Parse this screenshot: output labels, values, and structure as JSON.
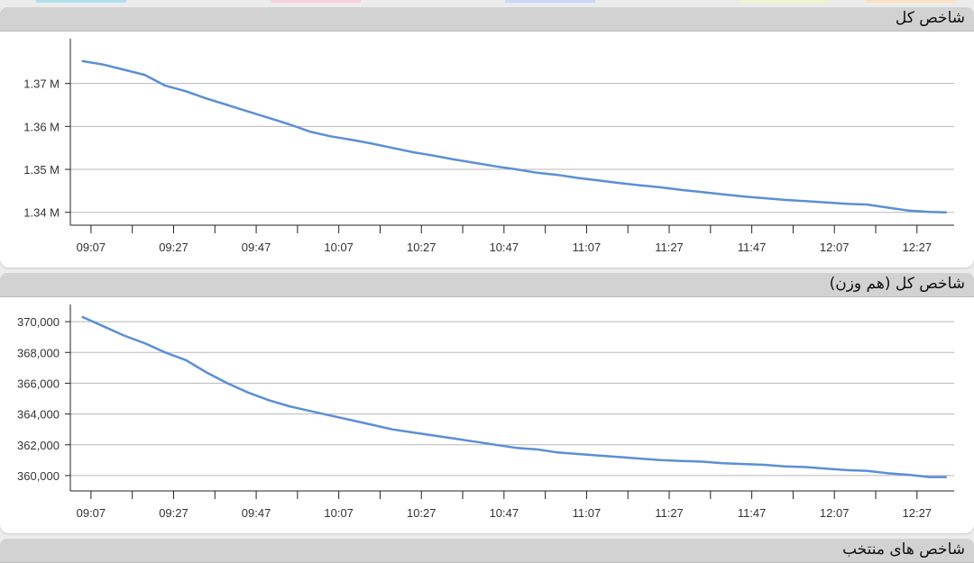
{
  "colors": {
    "line": "#5b8fd6",
    "grid": "#b8b8b8",
    "axis": "#222222",
    "header_bg": "#d2d2d2"
  },
  "top_tabs": [
    {
      "name": "tab-1",
      "color": "#aee0f0"
    },
    {
      "name": "tab-2",
      "color": "#f6d0dc"
    },
    {
      "name": "tab-3",
      "color": "#c9d8f7"
    },
    {
      "name": "tab-4",
      "color": "#f0f4c8"
    },
    {
      "name": "tab-5",
      "color": "#fde0c0"
    }
  ],
  "panels": [
    {
      "title": "شاخص کل"
    },
    {
      "title": "شاخص کل (هم وزن)"
    },
    {
      "title": "شاخص های منتخب"
    }
  ],
  "chart_data": [
    {
      "type": "line",
      "title": "شاخص کل",
      "xlabel": "",
      "ylabel": "",
      "x_ticks": [
        "09:07",
        "09:27",
        "09:47",
        "10:07",
        "10:27",
        "10:47",
        "11:07",
        "11:27",
        "11:47",
        "12:07",
        "12:27"
      ],
      "y_ticks": [
        1340000,
        1350000,
        1360000,
        1370000
      ],
      "y_tick_labels": [
        "1.34 M",
        "1.35 M",
        "1.36 M",
        "1.37 M"
      ],
      "xlim": [
        "09:02",
        "12:36"
      ],
      "ylim": [
        1337000,
        1380000
      ],
      "grid": true,
      "series": [
        {
          "x": [
            "09:05",
            "09:10",
            "09:15",
            "09:20",
            "09:25",
            "09:30",
            "09:35",
            "09:40",
            "09:45",
            "09:50",
            "09:55",
            "10:00",
            "10:05",
            "10:10",
            "10:15",
            "10:20",
            "10:25",
            "10:30",
            "10:35",
            "10:40",
            "10:45",
            "10:50",
            "10:55",
            "11:00",
            "11:05",
            "11:10",
            "11:15",
            "11:20",
            "11:25",
            "11:30",
            "11:35",
            "11:40",
            "11:45",
            "11:50",
            "11:55",
            "12:00",
            "12:05",
            "12:10",
            "12:15",
            "12:20",
            "12:25",
            "12:30",
            "12:34"
          ],
          "values": [
            1375200,
            1374400,
            1373200,
            1372000,
            1369500,
            1368200,
            1366500,
            1365000,
            1363500,
            1362000,
            1360500,
            1358800,
            1357700,
            1356900,
            1356000,
            1355000,
            1354000,
            1353200,
            1352300,
            1351500,
            1350700,
            1350000,
            1349200,
            1348700,
            1348000,
            1347400,
            1346800,
            1346300,
            1345800,
            1345200,
            1344700,
            1344200,
            1343700,
            1343300,
            1342900,
            1342600,
            1342300,
            1342000,
            1341800,
            1341100,
            1340400,
            1340100,
            1340000
          ]
        }
      ]
    },
    {
      "type": "line",
      "title": "شاخص کل (هم وزن)",
      "xlabel": "",
      "ylabel": "",
      "x_ticks": [
        "09:07",
        "09:27",
        "09:47",
        "10:07",
        "10:27",
        "10:47",
        "11:07",
        "11:27",
        "11:47",
        "12:07",
        "12:27"
      ],
      "y_ticks": [
        360000,
        362000,
        364000,
        366000,
        368000,
        370000
      ],
      "y_tick_labels": [
        "360,000",
        "362,000",
        "364,000",
        "366,000",
        "368,000",
        "370,000"
      ],
      "xlim": [
        "09:02",
        "12:36"
      ],
      "ylim": [
        359000,
        371000
      ],
      "grid": true,
      "series": [
        {
          "x": [
            "09:05",
            "09:10",
            "09:15",
            "09:20",
            "09:25",
            "09:30",
            "09:35",
            "09:40",
            "09:45",
            "09:50",
            "09:55",
            "10:00",
            "10:05",
            "10:10",
            "10:15",
            "10:20",
            "10:25",
            "10:30",
            "10:35",
            "10:40",
            "10:45",
            "10:50",
            "10:55",
            "11:00",
            "11:05",
            "11:10",
            "11:15",
            "11:20",
            "11:25",
            "11:30",
            "11:35",
            "11:40",
            "11:45",
            "11:50",
            "11:55",
            "12:00",
            "12:05",
            "12:10",
            "12:15",
            "12:20",
            "12:25",
            "12:30",
            "12:34"
          ],
          "values": [
            370300,
            369700,
            369100,
            368600,
            368000,
            367500,
            366700,
            366000,
            365400,
            364900,
            364500,
            364200,
            363900,
            363600,
            363300,
            363000,
            362800,
            362600,
            362400,
            362200,
            362000,
            361800,
            361700,
            361500,
            361400,
            361300,
            361200,
            361100,
            361000,
            360950,
            360900,
            360800,
            360750,
            360700,
            360600,
            360550,
            360450,
            360350,
            360300,
            360150,
            360050,
            359900,
            359900
          ]
        }
      ]
    }
  ]
}
